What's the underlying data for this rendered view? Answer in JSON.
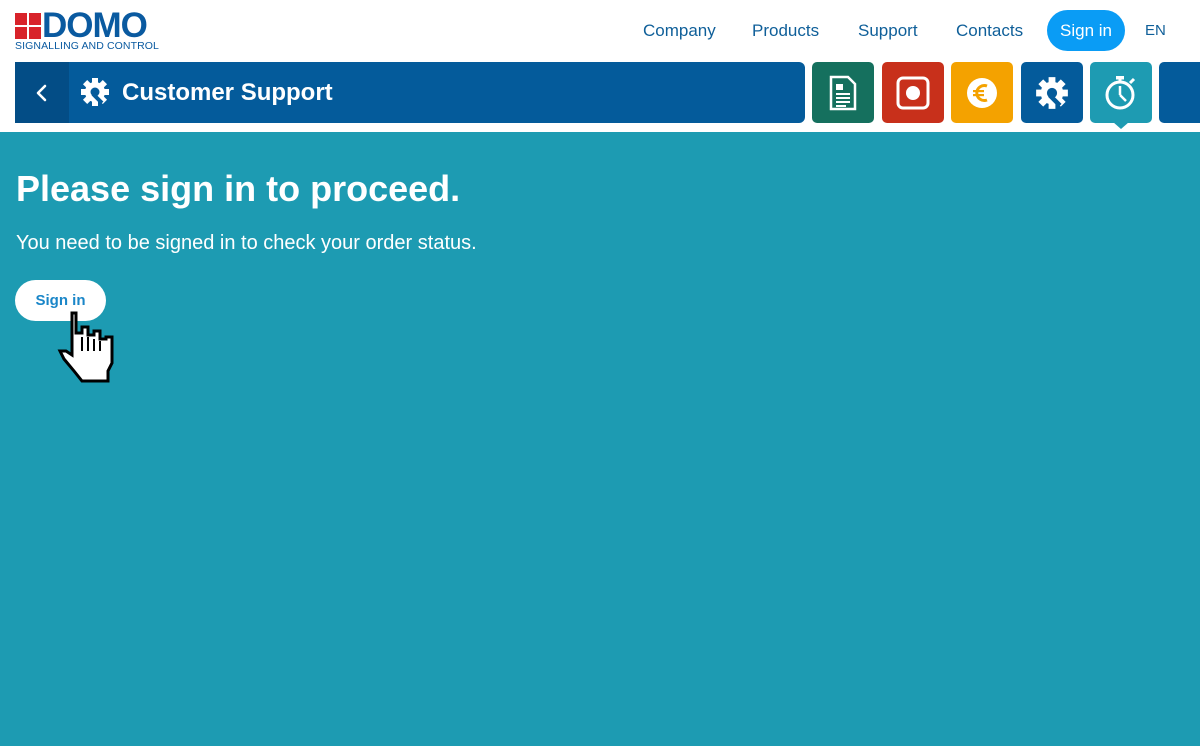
{
  "header": {
    "logo_word": "DOMO",
    "logo_tagline": "SIGNALLING AND CONTROL",
    "nav": [
      {
        "label": "Company"
      },
      {
        "label": "Products"
      },
      {
        "label": "Support"
      },
      {
        "label": "Contacts"
      }
    ],
    "signin_label": "Sign in",
    "language": "EN"
  },
  "section": {
    "title": "Customer Support",
    "icon": "gear-wrench-icon",
    "tiles": [
      {
        "icon": "document-icon",
        "color": "#15705e"
      },
      {
        "icon": "record-icon",
        "color": "#c8301b"
      },
      {
        "icon": "euro-icon",
        "color": "#f4a200"
      },
      {
        "icon": "gear-wrench-icon",
        "color": "#045b9b"
      },
      {
        "icon": "stopwatch-icon",
        "color": "#1e9bb2",
        "active": true
      }
    ]
  },
  "main": {
    "title": "Please sign in to proceed.",
    "message": "You need to be signed in to check your order status.",
    "signin_label": "Sign in"
  },
  "colors": {
    "brand_blue": "#045b9b",
    "accent_blue": "#0a9cf5",
    "main_bg": "#1d9bb2",
    "logo_red": "#d8232a"
  }
}
